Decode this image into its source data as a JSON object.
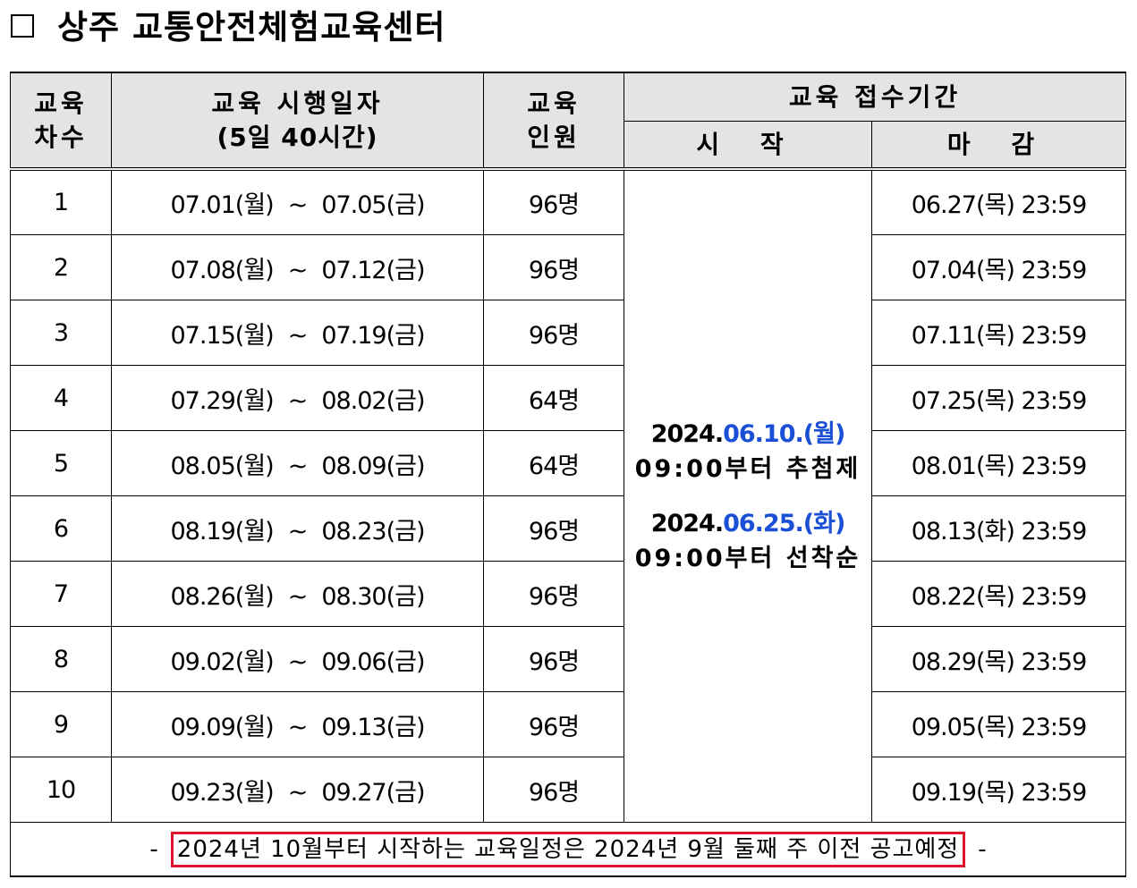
{
  "title": "상주 교통안전체험교육센터",
  "header": {
    "round": [
      "교육",
      "차수"
    ],
    "dates": [
      "교육 시행일자",
      "(5일 40시간)"
    ],
    "people": [
      "교육",
      "인원"
    ],
    "reception": "교육 접수기간",
    "start": "시 작",
    "end": "마 감"
  },
  "rows": [
    {
      "round": "1",
      "from": "07.01(월)",
      "to": "07.05(금)",
      "people": "96명",
      "deadline": "06.27(목) 23:59"
    },
    {
      "round": "2",
      "from": "07.08(월)",
      "to": "07.12(금)",
      "people": "96명",
      "deadline": "07.04(목) 23:59"
    },
    {
      "round": "3",
      "from": "07.15(월)",
      "to": "07.19(금)",
      "people": "96명",
      "deadline": "07.11(목) 23:59"
    },
    {
      "round": "4",
      "from": "07.29(월)",
      "to": "08.02(금)",
      "people": "64명",
      "deadline": "07.25(목) 23:59"
    },
    {
      "round": "5",
      "from": "08.05(월)",
      "to": "08.09(금)",
      "people": "64명",
      "deadline": "08.01(목) 23:59"
    },
    {
      "round": "6",
      "from": "08.19(월)",
      "to": "08.23(금)",
      "people": "96명",
      "deadline": "08.13(화) 23:59"
    },
    {
      "round": "7",
      "from": "08.26(월)",
      "to": "08.30(금)",
      "people": "96명",
      "deadline": "08.22(목) 23:59"
    },
    {
      "round": "8",
      "from": "09.02(월)",
      "to": "09.06(금)",
      "people": "96명",
      "deadline": "08.29(목) 23:59"
    },
    {
      "round": "9",
      "from": "09.09(월)",
      "to": "09.13(금)",
      "people": "96명",
      "deadline": "09.05(목) 23:59"
    },
    {
      "round": "10",
      "from": "09.23(월)",
      "to": "09.27(금)",
      "people": "96명",
      "deadline": "09.19(목) 23:59"
    }
  ],
  "tilde": "~",
  "start_info": {
    "first": {
      "year": "2024.",
      "date": "06.10.",
      "weekday": "(월)",
      "desc": "09:00부터 추첨제"
    },
    "second": {
      "year": "2024.",
      "date": "06.25.",
      "weekday": "(화)",
      "desc": "09:00부터 선착순"
    }
  },
  "footer": {
    "dash": "-",
    "note": "2024년 10월부터 시작하는 교육일정은 2024년 9월 둘째 주 이전 공고예정"
  },
  "colors": {
    "header_bg": "#e4e4e4",
    "highlight_blue": "#1a4fd6",
    "note_border": "#e0142d"
  }
}
